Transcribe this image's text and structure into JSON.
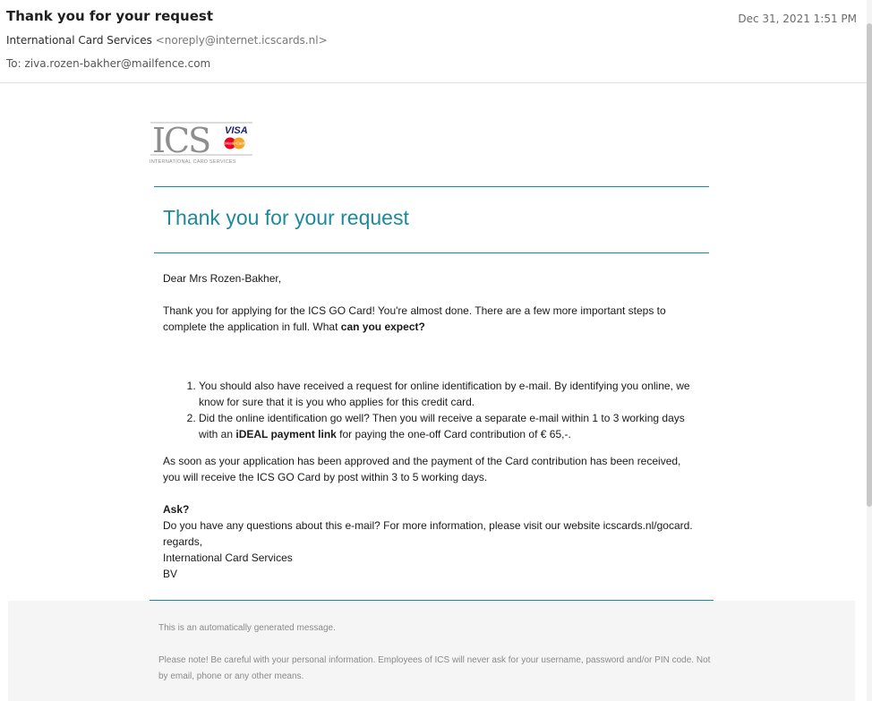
{
  "header": {
    "subject": "Thank you for your request",
    "date": "Dec 31, 2021 1:51 PM",
    "from_name": "International Card Services",
    "from_address": "<noreply@internet.icscards.nl>",
    "to_label": "To:",
    "to_address": "ziva.rozen-bakher@mailfence.com"
  },
  "logo": {
    "letters": "ICS",
    "visa": "VISA",
    "mastercard": "MasterCard",
    "tagline": "INTERNATIONAL CARD SERVICES",
    "colors": {
      "gray": "#8e8e8e",
      "visa_blue": "#1a1f71",
      "mc_red": "#eb001b",
      "mc_orange": "#f79e1b"
    }
  },
  "email": {
    "headline": "Thank you for your request",
    "greeting": "Dear Mrs Rozen-Bakher,",
    "intro_text": "Thank you for applying for the ICS GO Card! You're almost done. There are a few more important steps to complete the application in full. What ",
    "intro_bold": "can you expect?",
    "steps": [
      {
        "text": "You should also have received a request for online identification by e-mail. By identifying you online, we know for sure that it is you who applies for this credit card."
      },
      {
        "text_before": "Did the online identification go well? Then you will receive a separate e-mail within 1 to 3 working days with an ",
        "bold": "iDEAL payment link",
        "text_after": " for paying the one-off Card contribution of € 65,-."
      }
    ],
    "after_steps": "As soon as your application has been approved and the payment of the Card contribution has been received, you will receive the ICS GO Card by post within 3 to 5 working days.",
    "ask_heading": "Ask?",
    "ask_text": "Do you have any questions about this e-mail? For more information, please visit our website icscards.nl/gocard.",
    "regards": "regards,",
    "signature_line1": "International Card Services",
    "signature_line2": "BV"
  },
  "footer": {
    "auto_message": "This is an automatically generated message.",
    "warning": "Please note! Be careful with your personal information. Employees of ICS will never ask for your username, password and/or PIN code. Not by email, phone or any other means."
  },
  "colors": {
    "accent": "#1c8a9c"
  }
}
